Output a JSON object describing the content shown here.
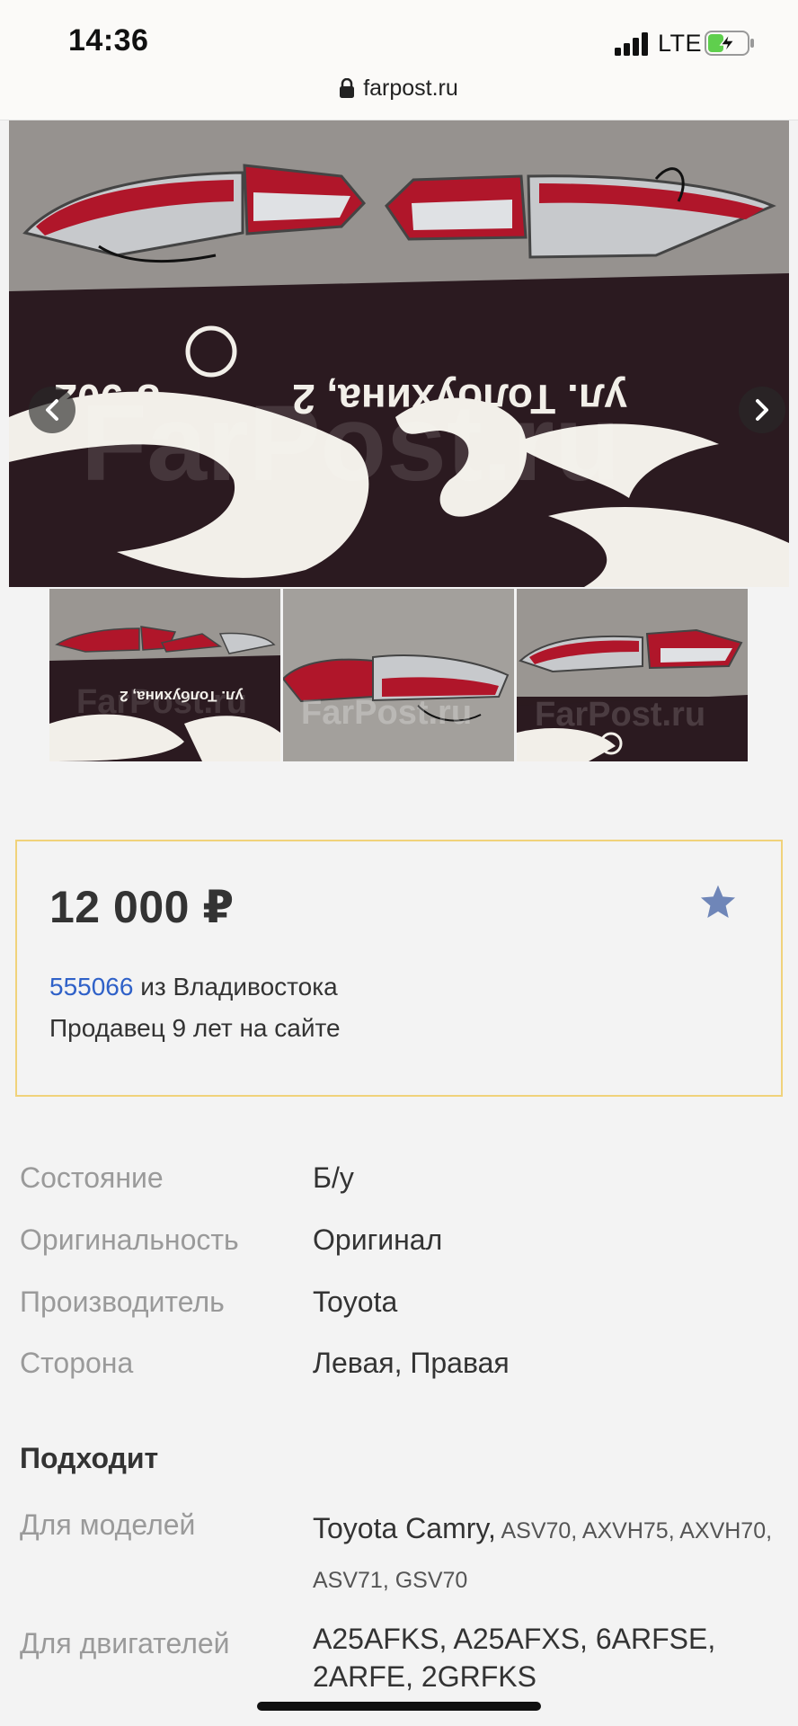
{
  "status_bar": {
    "time": "14:36",
    "network": "LTE",
    "battery_charging": true
  },
  "browser": {
    "url": "farpost.ru"
  },
  "gallery": {
    "watermark": "FarPost.ru",
    "banner_text_1": "ул. Толбухина, 2",
    "banner_text_2": "8-902",
    "thumbnail_count": 3
  },
  "listing": {
    "price": "12 000 ₽",
    "seller_id": "555066",
    "seller_city": " из Владивостока",
    "seller_age": "Продавец 9 лет на сайте"
  },
  "specs": [
    {
      "label": "Состояние",
      "value": "Б/у"
    },
    {
      "label": "Оригинальность",
      "value": "Оригинал"
    },
    {
      "label": "Производитель",
      "value": "Toyota"
    },
    {
      "label": "Сторона",
      "value": "Левая, Правая"
    }
  ],
  "fits": {
    "title": "Подходит",
    "models_label": "Для моделей",
    "models_main": "Toyota Camry,",
    "models_codes": " ASV70, AXVH75, AXVH70, ASV71, GSV70",
    "engines_label": "Для двигателей",
    "engines_value": "A25AFKS, A25AFXS, 6ARFSE, 2ARFE, 2GRFKS"
  },
  "colors": {
    "accent_border": "#f0d27a",
    "link": "#2f61c8",
    "star": "#6f86b8"
  }
}
